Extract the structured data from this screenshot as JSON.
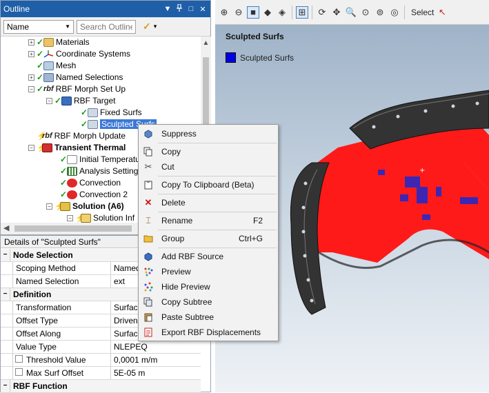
{
  "outline": {
    "title": "Outline",
    "header_buttons": [
      "▼",
      "ф",
      "□",
      "✕"
    ],
    "filter_combo": "Name",
    "search_placeholder": "Search Outline",
    "tree": [
      {
        "label": "Materials",
        "icon": "materials-icon",
        "status": "ok"
      },
      {
        "label": "Coordinate Systems",
        "icon": "coordinate-systems-icon",
        "status": "ok"
      },
      {
        "label": "Mesh",
        "icon": "mesh-icon",
        "status": "ok"
      },
      {
        "label": "Named Selections",
        "icon": "named-selections-icon",
        "status": "ok"
      },
      {
        "label": "RBF Morph Set Up",
        "icon": "rbf-icon",
        "status": "ok",
        "prefix": "rbf"
      },
      {
        "label": "RBF Target",
        "icon": "rbf-target-icon",
        "status": "ok"
      },
      {
        "label": "Fixed Surfs",
        "icon": "fixed-surfs-icon",
        "status": "ok"
      },
      {
        "label": "Sculpted Surfs",
        "icon": "sculpted-surfs-icon",
        "status": "ok",
        "selected": true
      },
      {
        "label": "RBF Morph Update",
        "icon": "rbf-update-icon",
        "status": "lightning",
        "prefix": "rbf"
      },
      {
        "label": "Transient Thermal",
        "icon": "transient-thermal-icon",
        "status": "lightning",
        "bold": true
      },
      {
        "label": "Initial Temperatu",
        "icon": "initial-temperature-icon",
        "status": "ok"
      },
      {
        "label": "Analysis Settings",
        "icon": "analysis-settings-icon",
        "status": "ok"
      },
      {
        "label": "Convection",
        "icon": "convection-icon",
        "status": "ok"
      },
      {
        "label": "Convection 2",
        "icon": "convection-icon",
        "status": "ok"
      },
      {
        "label": "Solution (A6)",
        "icon": "solution-icon",
        "status": "lightning",
        "bold": true
      },
      {
        "label": "Solution Inf",
        "icon": "solution-info-icon",
        "status": "lightning"
      }
    ]
  },
  "details": {
    "title": "Details of \"Sculpted Surfs\"",
    "sections": [
      {
        "type": "section",
        "label": "Node Selection"
      },
      {
        "type": "row",
        "key": "Scoping Method",
        "value": "Named"
      },
      {
        "type": "row",
        "key": "Named Selection",
        "value": "ext"
      },
      {
        "type": "section",
        "label": "Definition"
      },
      {
        "type": "row",
        "key": "Transformation",
        "value": "Surfac"
      },
      {
        "type": "row",
        "key": "Offset Type",
        "value": "Driven"
      },
      {
        "type": "row",
        "key": "Offset Along",
        "value": "Surfac"
      },
      {
        "type": "row",
        "key": "Value Type",
        "value": "NLEPEQ"
      },
      {
        "type": "checkrow",
        "key": "Threshold Value",
        "value": "0,0001 m/m"
      },
      {
        "type": "checkrow",
        "key": "Max Surf Offset",
        "value": "5E-05 m"
      },
      {
        "type": "section",
        "label": "RBF Function"
      }
    ]
  },
  "graphics": {
    "toolbar_select_label": "Select",
    "viewport_title": "Sculpted Surfs",
    "legend_label": "Sculpted Surfs",
    "legend_color": "#0000e6",
    "model_color": "#ff1a1a"
  },
  "context_menu": {
    "items": [
      {
        "label": "Suppress",
        "icon": "suppress-icon",
        "shortcut": ""
      },
      {
        "label": "Copy",
        "icon": "copy-icon",
        "shortcut": ""
      },
      {
        "label": "Cut",
        "icon": "cut-icon",
        "shortcut": ""
      },
      {
        "label": "Copy To Clipboard (Beta)",
        "icon": "clipboard-icon",
        "shortcut": ""
      },
      {
        "label": "Delete",
        "icon": "delete-icon",
        "shortcut": ""
      },
      {
        "label": "Rename",
        "icon": "rename-icon",
        "shortcut": "F2"
      },
      {
        "label": "Group",
        "icon": "group-icon",
        "shortcut": "Ctrl+G"
      },
      {
        "label": "Add RBF Source",
        "icon": "add-rbf-source-icon",
        "shortcut": ""
      },
      {
        "label": "Preview",
        "icon": "preview-icon",
        "shortcut": ""
      },
      {
        "label": "Hide Preview",
        "icon": "hide-preview-icon",
        "shortcut": ""
      },
      {
        "label": "Copy Subtree",
        "icon": "copy-subtree-icon",
        "shortcut": ""
      },
      {
        "label": "Paste Subtree",
        "icon": "paste-subtree-icon",
        "shortcut": ""
      },
      {
        "label": "Export RBF Displacements",
        "icon": "export-rbf-displacements-icon",
        "shortcut": ""
      }
    ]
  }
}
